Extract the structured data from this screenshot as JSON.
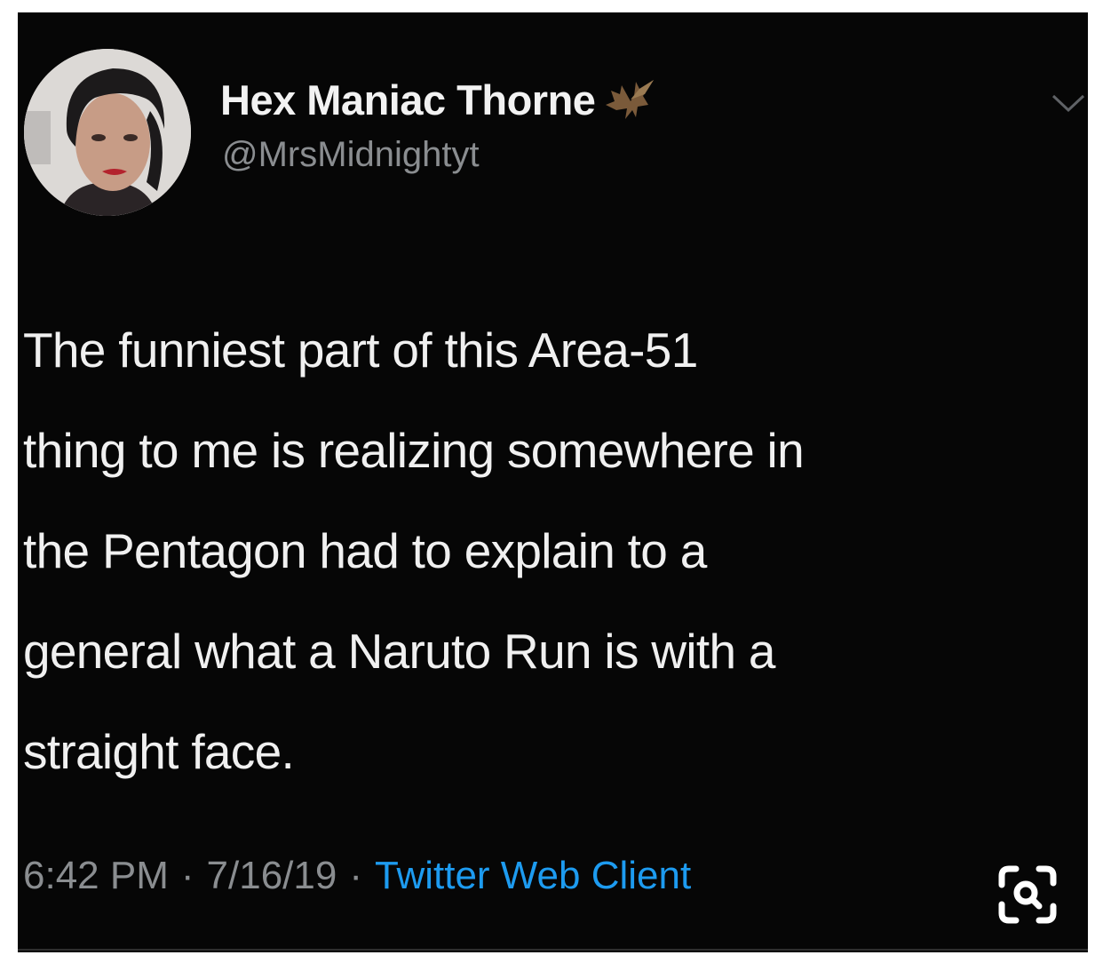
{
  "tweet": {
    "author": {
      "display_name": "Hex Maniac Thorne",
      "handle": "@MrsMidnightyt",
      "name_emoji_icon": "bat-icon"
    },
    "text": "The funniest part of this Area-51\nthing to me is realizing somewhere in\nthe Pentagon had to explain to a\ngeneral what a Naruto Run is with a\nstraight face.",
    "time": "6:42 PM",
    "date": "7/16/19",
    "separator": "·",
    "client": "Twitter Web Client"
  },
  "icons": {
    "menu": "chevron-down-icon",
    "overlay": "visual-search-icon"
  },
  "colors": {
    "background": "#060606",
    "text": "#f0f0f0",
    "muted": "#8a8d90",
    "link": "#1d9bf0"
  }
}
